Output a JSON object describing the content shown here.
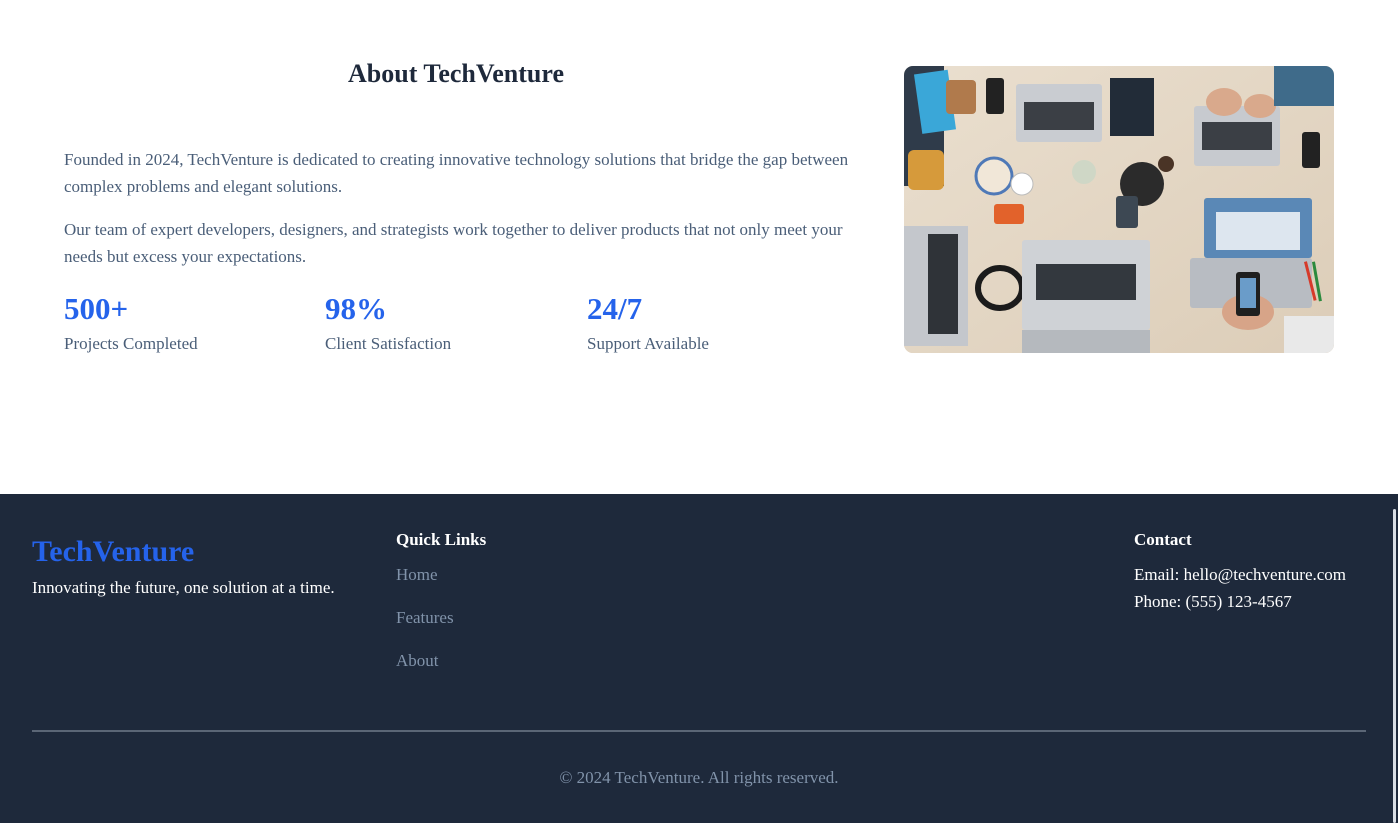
{
  "about": {
    "title": "About TechVenture",
    "paragraphs": [
      "Founded in 2024, TechVenture is dedicated to creating innovative technology solutions that bridge the gap between complex problems and elegant solutions.",
      "Our team of expert developers, designers, and strategists work together to deliver products that not only meet your needs but excess your expectations."
    ],
    "stats": [
      {
        "value": "500+",
        "label": "Projects Completed"
      },
      {
        "value": "98%",
        "label": "Client Satisfaction"
      },
      {
        "value": "24/7",
        "label": "Support Available"
      }
    ],
    "image_icon": "team-desk-laptops-photo"
  },
  "footer": {
    "brand": "TechVenture",
    "tagline": "Innovating the future, one solution at a time.",
    "quick_links_heading": "Quick Links",
    "links": [
      "Home",
      "Features",
      "About"
    ],
    "contact_heading": "Contact",
    "email": "Email: hello@techventure.com",
    "phone": "Phone: (555) 123-4567",
    "copyright": "© 2024 TechVenture. All rights reserved."
  },
  "colors": {
    "accent": "#2563eb",
    "footer_bg": "#1e293b",
    "body_text": "#4a5e78",
    "link_text": "#8193aa"
  }
}
